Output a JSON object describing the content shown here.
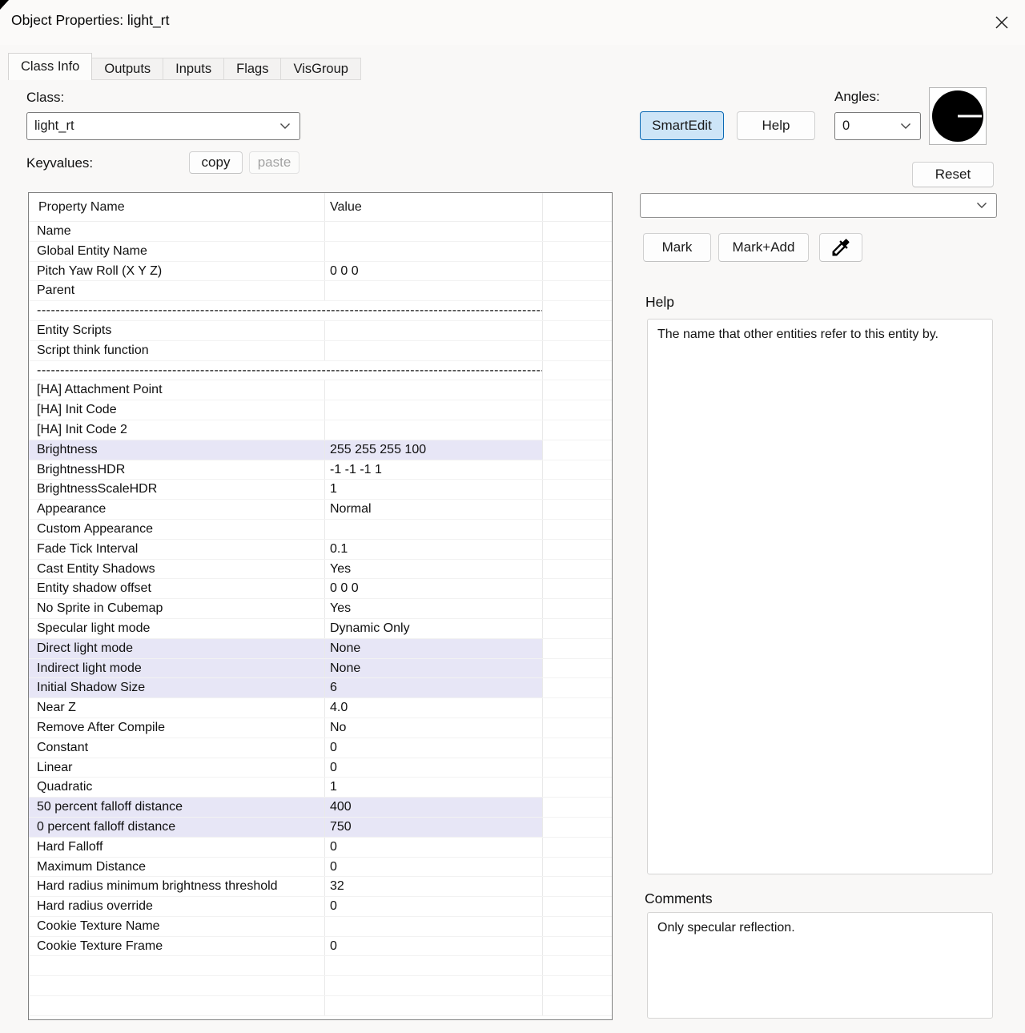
{
  "window": {
    "title": "Object Properties: light_rt"
  },
  "tabs": [
    {
      "label": "Class Info",
      "active": true
    },
    {
      "label": "Outputs",
      "active": false
    },
    {
      "label": "Inputs",
      "active": false
    },
    {
      "label": "Flags",
      "active": false
    },
    {
      "label": "VisGroup",
      "active": false
    }
  ],
  "class_section": {
    "label": "Class:",
    "value": "light_rt"
  },
  "keyvalues": {
    "label": "Keyvalues:",
    "copy_label": "copy",
    "paste_label": "paste"
  },
  "angles": {
    "label": "Angles:",
    "value": "0",
    "dial_angle_degrees": 0
  },
  "toolbar": {
    "smartedit": "SmartEdit",
    "help": "Help",
    "reset": "Reset",
    "filter_value": "",
    "mark": "Mark",
    "mark_add": "Mark+Add",
    "eyedropper_icon": "eyedropper-icon"
  },
  "table": {
    "headers": [
      "Property Name",
      "Value"
    ],
    "rows": [
      {
        "label": "Name",
        "value": ""
      },
      {
        "label": "Global Entity Name",
        "value": ""
      },
      {
        "label": "Pitch Yaw Roll (X Y Z)",
        "value": "0 0 0"
      },
      {
        "label": "Parent",
        "value": ""
      },
      {
        "separator": true,
        "dashes": "-----------------------------------------------------------------------------------------------------------------"
      },
      {
        "label": "Entity Scripts",
        "value": ""
      },
      {
        "label": "Script think function",
        "value": ""
      },
      {
        "separator": true,
        "dashes": "--------------------------------------------------------------------------------------------------------------------"
      },
      {
        "label": "[HA] Attachment Point",
        "value": ""
      },
      {
        "label": "[HA] Init Code",
        "value": ""
      },
      {
        "label": "[HA] Init Code 2",
        "value": ""
      },
      {
        "label": "Brightness",
        "value": "255 255 255 100",
        "highlight": true
      },
      {
        "label": "BrightnessHDR",
        "value": "-1 -1 -1 1"
      },
      {
        "label": "BrightnessScaleHDR",
        "value": "1"
      },
      {
        "label": "Appearance",
        "value": "Normal"
      },
      {
        "label": "Custom Appearance",
        "value": ""
      },
      {
        "label": "Fade Tick Interval",
        "value": "0.1"
      },
      {
        "label": "Cast Entity Shadows",
        "value": "Yes"
      },
      {
        "label": "Entity shadow offset",
        "value": "0 0 0"
      },
      {
        "label": "No Sprite in Cubemap",
        "value": "Yes"
      },
      {
        "label": "Specular light mode",
        "value": "Dynamic Only"
      },
      {
        "label": "Direct light mode",
        "value": "None",
        "highlight": true
      },
      {
        "label": "Indirect light mode",
        "value": "None",
        "highlight": true
      },
      {
        "label": "Initial Shadow Size",
        "value": "6",
        "highlight": true
      },
      {
        "label": "Near Z",
        "value": "4.0"
      },
      {
        "label": "Remove After Compile",
        "value": "No"
      },
      {
        "label": "Constant",
        "value": "0"
      },
      {
        "label": "Linear",
        "value": "0"
      },
      {
        "label": "Quadratic",
        "value": "1"
      },
      {
        "label": "50 percent falloff distance",
        "value": "400",
        "highlight": true
      },
      {
        "label": "0 percent falloff distance",
        "value": "750",
        "highlight": true
      },
      {
        "label": "Hard Falloff",
        "value": "0"
      },
      {
        "label": "Maximum Distance",
        "value": "0"
      },
      {
        "label": "Hard radius minimum brightness threshold",
        "value": "32"
      },
      {
        "label": "Hard radius override",
        "value": "0"
      },
      {
        "label": "Cookie Texture Name",
        "value": ""
      },
      {
        "label": "Cookie Texture Frame",
        "value": "0"
      },
      {
        "label": "",
        "value": ""
      },
      {
        "label": "",
        "value": ""
      },
      {
        "label": "",
        "value": ""
      }
    ]
  },
  "help_panel": {
    "label": "Help",
    "text": "The name that other entities refer to this entity by."
  },
  "comments": {
    "label": "Comments",
    "text": "Only specular reflection."
  },
  "colors": {
    "smartedit_bg": "#cde5f7",
    "smartedit_border": "#0b69b4",
    "row_highlight": "#e7e6f6",
    "dialog_bg": "#f9f8f7",
    "table_border": "#808080"
  }
}
